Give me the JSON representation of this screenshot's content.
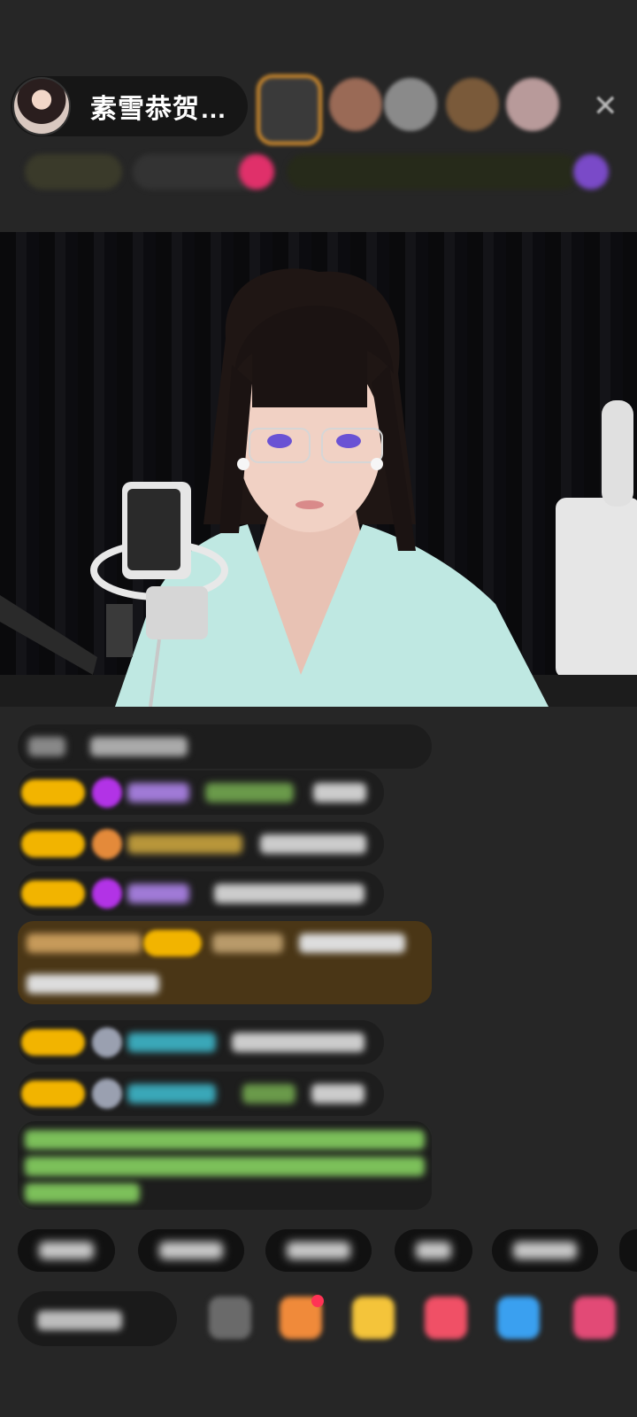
{
  "host": {
    "name": "素雪恭贺…"
  },
  "icons": {
    "close": "close-icon",
    "more_chat": "chat-emoji-icon"
  },
  "colors": {
    "background": "#262626",
    "badge_gold": "#f2b400",
    "highlight_bar": "#4a3616",
    "system_text_green": "#8fd46a"
  }
}
